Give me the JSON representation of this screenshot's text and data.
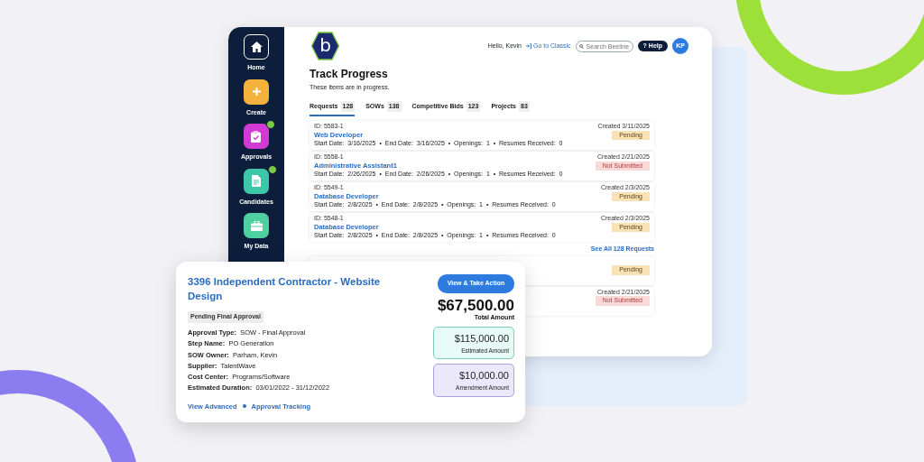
{
  "sidebar": {
    "items": [
      {
        "label": "Home",
        "notification": false
      },
      {
        "label": "Create",
        "notification": false
      },
      {
        "label": "Approvals",
        "notification": true
      },
      {
        "label": "Candidates",
        "notification": true
      },
      {
        "label": "My Data",
        "notification": false
      }
    ]
  },
  "header": {
    "logo": "b",
    "greeting": "Hello, Kevin",
    "classic_link": "Go to Classic",
    "search": {
      "placeholder": "Search Beeline"
    },
    "help_button": "? Help",
    "avatar": "KP"
  },
  "page": {
    "title": "Track Progress",
    "subtitle": "These items are in progress."
  },
  "tabs": [
    {
      "label": "Requests",
      "count": "128",
      "selected": true
    },
    {
      "label": "SOWs",
      "count": "138",
      "selected": false
    },
    {
      "label": "Competitive Bids",
      "count": "123",
      "selected": false
    },
    {
      "label": "Projects",
      "count": "83",
      "selected": false
    }
  ],
  "requests": [
    {
      "id": "ID: 5583-1",
      "title": "Web Developer",
      "details": "Start Date:  3/16/2025  •  End Date:  3/16/2025  •  Openings:  1  •  Resumes Received:  0",
      "created": "Created 3/11/2025",
      "status": {
        "text": "Pending",
        "kind": "pending"
      }
    },
    {
      "id": "ID: 5558-1",
      "title": "Administrative Assistant1",
      "details": "Start Date:  2/26/2025  •  End Date:  2/26/2025  •  Openings:  1  •  Resumes Received:  0",
      "created": "Created 2/21/2025",
      "status": {
        "text": "Not Submitted",
        "kind": "not_submitted"
      }
    },
    {
      "id": "ID: 5549-1",
      "title": "Database Developer",
      "details": "Start Date:  2/8/2025  •  End Date:  2/8/2025  •  Openings:  1  •  Resumes Received:  0",
      "created": "Created 2/3/2025",
      "status": {
        "text": "Pending",
        "kind": "pending"
      }
    },
    {
      "id": "ID: 5548-1",
      "title": "Database Developer",
      "details": "Start Date:  2/8/2025  •  End Date:  2/8/2025  •  Openings:  1  •  Resumes Received:  0",
      "created": "Created 2/3/2025",
      "status": {
        "text": "Pending",
        "kind": "pending"
      }
    }
  ],
  "see_all": "See All 128 Requests",
  "covered_requests": [
    {
      "status": {
        "text": "Pending",
        "kind": "pending"
      }
    },
    {
      "created": "Created 2/21/2025",
      "status": {
        "text": "Not Submitted",
        "kind": "not_submitted"
      }
    }
  ],
  "approval_card": {
    "title": "3396 Independent Contractor - Website Design",
    "badge": "Pending Final Approval",
    "fields": [
      {
        "label": "Approval Type:",
        "value": "SOW - Final Approval"
      },
      {
        "label": "Step Name:",
        "value": "PO Generation"
      },
      {
        "label": "SOW Owner:",
        "value": "Parham, Kevin"
      },
      {
        "label": "Supplier:",
        "value": "TalentWave"
      },
      {
        "label": "Cost Center:",
        "value": "Programs/Software"
      },
      {
        "label": "Estimated Duration:",
        "value": "03/01/2022 - 31/12/2022"
      }
    ],
    "links": [
      "View Advanced",
      "Approval Tracking"
    ],
    "action_button": "View & Take Action",
    "total": {
      "amount": "$67,500.00",
      "label": "Total Amount"
    },
    "amounts": [
      {
        "amount": "$115,000.00",
        "label": "Estimated Amount",
        "kind": "estimated"
      },
      {
        "amount": "$10,000.00",
        "label": "Amendment Amount",
        "kind": "amendment"
      }
    ]
  }
}
